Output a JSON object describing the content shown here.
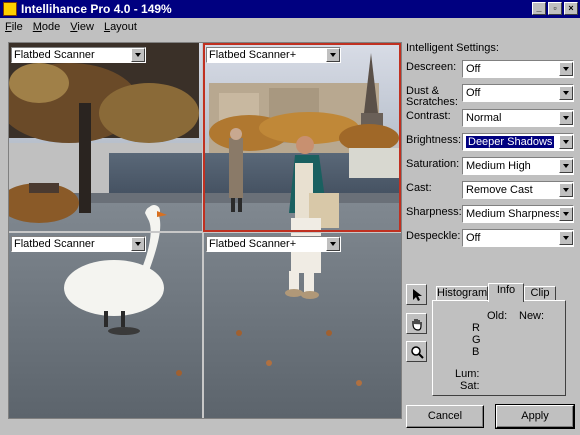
{
  "window": {
    "title": "Intellihance Pro 4.0 - 149%"
  },
  "menu": [
    "File",
    "Mode",
    "View",
    "Layout"
  ],
  "quadrants": [
    {
      "label": "Flatbed Scanner"
    },
    {
      "label": "Flatbed Scanner+"
    },
    {
      "label": "Flatbed Scanner"
    },
    {
      "label": "Flatbed Scanner+"
    }
  ],
  "settings": {
    "heading": "Intelligent Settings:",
    "rows": [
      {
        "label": "Descreen:",
        "value": "Off"
      },
      {
        "label": "Dust & Scratches:",
        "value": "Off"
      },
      {
        "label": "Contrast:",
        "value": "Normal"
      },
      {
        "label": "Brightness:",
        "value": "Deeper Shadows"
      },
      {
        "label": "Saturation:",
        "value": "Medium High"
      },
      {
        "label": "Cast:",
        "value": "Remove Cast"
      },
      {
        "label": "Sharpness:",
        "value": "Medium Sharpness"
      },
      {
        "label": "Despeckle:",
        "value": "Off"
      }
    ]
  },
  "tools": [
    {
      "icon": "arrow-pointer-icon"
    },
    {
      "icon": "hand-icon"
    },
    {
      "icon": "magnifier-icon"
    }
  ],
  "tabs": [
    "Histogram",
    "Info",
    "Clip"
  ],
  "info": {
    "old_label": "Old:",
    "new_label": "New:",
    "channels": [
      "R",
      "G",
      "B"
    ],
    "lum_label": "Lum:",
    "sat_label": "Sat:"
  },
  "buttons": {
    "cancel": "Cancel",
    "apply": "Apply"
  },
  "colors": {
    "titlebar": "#000080",
    "selection_border": "#c03020",
    "highlight": "#000080"
  }
}
